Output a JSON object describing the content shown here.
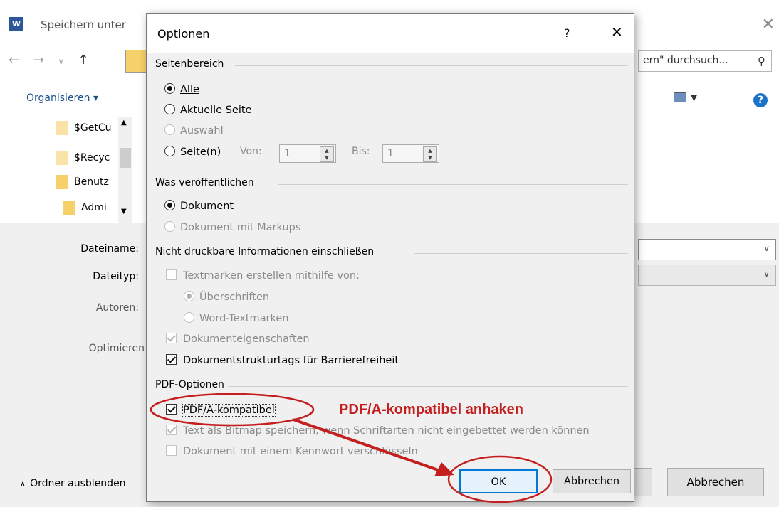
{
  "background_window": {
    "title": "Speichern unter",
    "app_icon_letter": "W",
    "search_placeholder": "ern\" durchsuch...",
    "organize_label": "Organisieren ▾",
    "tree_items": [
      "$GetCu",
      "$Recyc",
      "Benutz",
      "Admi"
    ],
    "labels": {
      "filename": "Dateiname:",
      "filetype": "Dateityp:",
      "authors": "Autoren:",
      "optimize": "Optimieren"
    },
    "hide_folders": "Ordner ausblenden",
    "cancel_button": "Abbrechen"
  },
  "dialog": {
    "title": "Optionen",
    "help_glyph": "?",
    "close_glyph": "✕",
    "page_range": {
      "title": "Seitenbereich",
      "all": "Alle",
      "current_page": "Aktuelle Seite",
      "selection": "Auswahl",
      "pages": "Seite(n)",
      "from_label": "Von:",
      "from_value": "1",
      "to_label": "Bis:",
      "to_value": "1"
    },
    "publish": {
      "title": "Was veröffentlichen",
      "document": "Dokument",
      "document_markups": "Dokument mit Markups"
    },
    "nonprint": {
      "title": "Nicht druckbare Informationen einschließen",
      "bookmarks": "Textmarken erstellen mithilfe von:",
      "headings": "Überschriften",
      "word_bookmarks": "Word-Textmarken",
      "doc_properties": "Dokumenteigenschaften",
      "structure_tags": "Dokumentstrukturtags für Barrierefreiheit"
    },
    "pdf_options": {
      "title": "PDF-Optionen",
      "pdfa": "PDF/A-kompatibel",
      "bitmap_text": "Text als Bitmap speichern, wenn Schriftarten nicht eingebettet werden können",
      "encrypt": "Dokument mit einem Kennwort verschlüsseln"
    },
    "ok_button": "OK",
    "cancel_button": "Abbrechen"
  },
  "annotation": {
    "text": "PDF/A-kompatibel anhaken",
    "color": "#c41e1e"
  },
  "colors": {
    "accent": "#0078d7",
    "dialog_bg": "#f0f0f0",
    "folder": "#f6d16a"
  }
}
